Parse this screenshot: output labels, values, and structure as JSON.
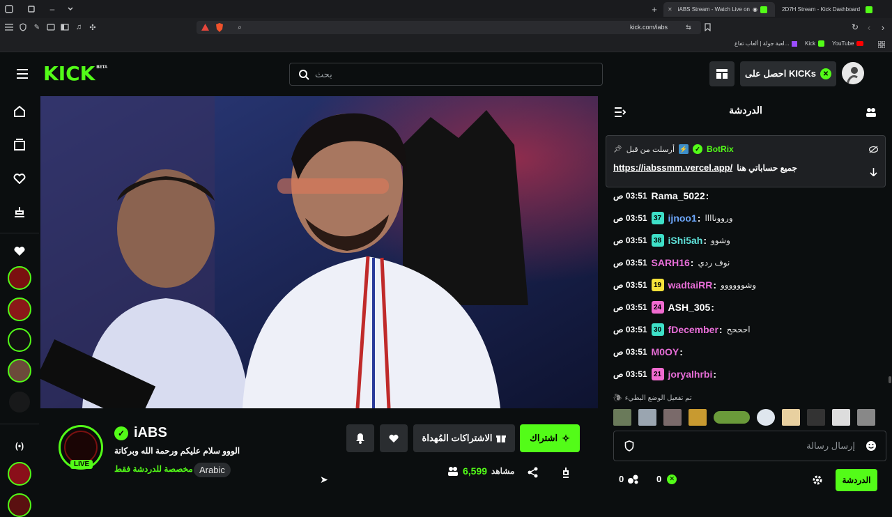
{
  "browser": {
    "tabs": [
      {
        "label": "iABS Stream - Watch Live on"
      },
      {
        "label": "2D7H Stream - Kick Dashboard"
      }
    ],
    "url": "kick.com/iabs",
    "bookmarks": [
      {
        "label": "لعبة جولة | ألعاب تفاع..."
      },
      {
        "label": "Kick"
      },
      {
        "label": "YouTube"
      }
    ]
  },
  "header": {
    "logo": "KICK",
    "logo_badge": "BETA",
    "search_placeholder": "بحث",
    "get_kicks_label": "احصل على KICKs"
  },
  "stream": {
    "channel_name": "iABS",
    "title": "الووو سلام عليكم ورحمة الله وبركاتة",
    "chat_mode": "مخصصة للدردشة فقط",
    "language": "Arabic",
    "live_label": "LIVE",
    "viewers": "6,599",
    "viewers_label": "مشاهد",
    "subscribe_label": "اشتراك",
    "gift_subs_label": "الاشتراكات المُهداة"
  },
  "chat": {
    "title": "الدردشة",
    "pinned": {
      "user": "BotRix",
      "sent_before": "أرسلت من قبل",
      "text": "جميع حساباتي هنا",
      "link": "https://iabssmm.vercel.app/"
    },
    "messages": [
      {
        "time": "03:51 ص",
        "user": "Rama_5022",
        "color": "#ffffff",
        "badge": "",
        "badge_color": "",
        "text": ""
      },
      {
        "time": "03:51 ص",
        "user": "ijnoo1",
        "color": "#6ea9ff",
        "badge": "37",
        "badge_color": "#3ee0c8",
        "text": "ورووناااا"
      },
      {
        "time": "03:51 ص",
        "user": "iShi5ah",
        "color": "#5fe1d9",
        "badge": "38",
        "badge_color": "#3ee0c8",
        "text": "وشوو"
      },
      {
        "time": "03:51 ص",
        "user": "SARH16",
        "color": "#e86ed8",
        "badge": "",
        "badge_color": "",
        "text": "نوف ردي"
      },
      {
        "time": "03:51 ص",
        "user": "wadtaiRR",
        "color": "#e86ed8",
        "badge": "19",
        "badge_color": "#f5e23a",
        "text": "وشوووووو"
      },
      {
        "time": "03:51 ص",
        "user": "ASH_305",
        "color": "#ffffff",
        "badge": "24",
        "badge_color": "#f06bd0",
        "text": ""
      },
      {
        "time": "03:51 ص",
        "user": "fDecember",
        "color": "#e86ed8",
        "badge": "30",
        "badge_color": "#3ee0c8",
        "text": "احححح"
      },
      {
        "time": "03:51 ص",
        "user": "M0OY",
        "color": "#e86ed8",
        "badge": "",
        "badge_color": "",
        "text": ""
      },
      {
        "time": "03:51 ص",
        "user": "joryalhrbi",
        "color": "#e86ed8",
        "badge": "21",
        "badge_color": "#f06bd0",
        "text": ""
      }
    ],
    "slow_mode_notice": "تم تفعيل الوضع البطيء",
    "input_placeholder": "إرسال رسالة",
    "send_label": "الدردشة",
    "count_a": "0",
    "count_b": "0"
  },
  "colors": {
    "accent": "#53fc18",
    "background": "#0b0e0f"
  }
}
